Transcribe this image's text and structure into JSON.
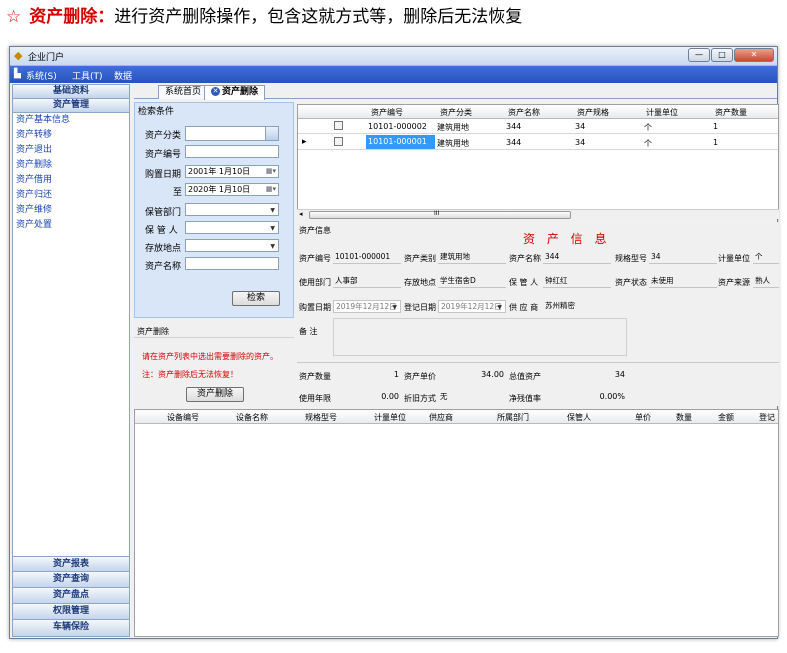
{
  "heading": {
    "star": "☆",
    "highlight": "资产删除：",
    "text": "进行资产删除操作，包含这就方式等，删除后无法恢复"
  },
  "window": {
    "title": "企业门户",
    "btn_min": "—",
    "btn_max": "□",
    "btn_close": "✕"
  },
  "menu": {
    "system": "系统(S)",
    "tools": "工具(T)",
    "data": "数据"
  },
  "sidebar": {
    "header_basic": "基础资料",
    "header_asset": "资产管理",
    "items": [
      "资产基本信息",
      "资产转移",
      "资产退出",
      "资产删除",
      "资产借用",
      "资产归还",
      "资产维修",
      "资产处置"
    ],
    "bottom": [
      "资产报表",
      "资产查询",
      "资产盘点",
      "权限管理",
      "车辆保险"
    ]
  },
  "tabs": {
    "home": "系统首页",
    "active": "资产删除",
    "close_icon": "✕"
  },
  "search": {
    "title": "检索条件",
    "category_label": "资产分类",
    "code_label": "资产编号",
    "date_label": "购置日期",
    "date_from": "2001年 1月10日",
    "to_label": "至",
    "date_to": "2020年 1月10日",
    "dept_label": "保管部门",
    "keeper_label": "保 管 人",
    "location_label": "存放地点",
    "name_label": "资产名称",
    "search_button": "检索"
  },
  "delete_panel": {
    "title": "资产删除",
    "hint": "请在资产列表中选出需要删除的资产。",
    "warning": "注：资产删除后无法恢复！",
    "button": "资产删除"
  },
  "asset_grid": {
    "columns": [
      "资产编号",
      "资产分类",
      "资产名称",
      "资产规格",
      "计量单位",
      "资产数量"
    ],
    "rows": [
      [
        "10101-000002",
        "建筑用地",
        "344",
        "34",
        "个",
        "1"
      ],
      [
        "10101-000001",
        "建筑用地",
        "344",
        "34",
        "个",
        "1"
      ]
    ],
    "row_pointer": "▸",
    "scroll_grip": "III"
  },
  "info": {
    "section": "资产信息",
    "title": "资 产 信 息",
    "code_label": "资产编号",
    "code": "10101-000001",
    "type_label": "资产类别",
    "type": "建筑用地",
    "name_label": "资产名称",
    "name": "344",
    "model_label": "规格型号",
    "model": "34",
    "unit_label": "计量单位",
    "unit": "个",
    "dept_label": "使用部门",
    "dept": "人事部",
    "loc_label": "存放地点",
    "loc": "学生宿舍D",
    "keeper_label": "保 管 人",
    "keeper": "钟红红",
    "status_label": "资产状态",
    "status": "未使用",
    "source_label": "资产来源",
    "source": "熟人",
    "buy_label": "购置日期",
    "buy": "2019年12月12日",
    "reg_label": "登记日期",
    "reg": "2019年12月12日",
    "supplier_label": "供 应 商",
    "supplier": "苏州精密",
    "remark_label": "备  注",
    "qty_label": "资产数量",
    "qty": "1",
    "price_label": "资产单价",
    "price": "34.00",
    "total_label": "总值资产",
    "total": "34",
    "years_label": "使用年限",
    "years": "0.00",
    "dep_label": "折旧方式",
    "dep": "无",
    "residual_label": "净残值率",
    "residual": "0.00%"
  },
  "detail_grid": {
    "columns": [
      "设备编号",
      "设备名称",
      "规格型号",
      "计量单位",
      "供应商",
      "所属部门",
      "保管人",
      "单价",
      "数量",
      "金额",
      "登记"
    ]
  }
}
